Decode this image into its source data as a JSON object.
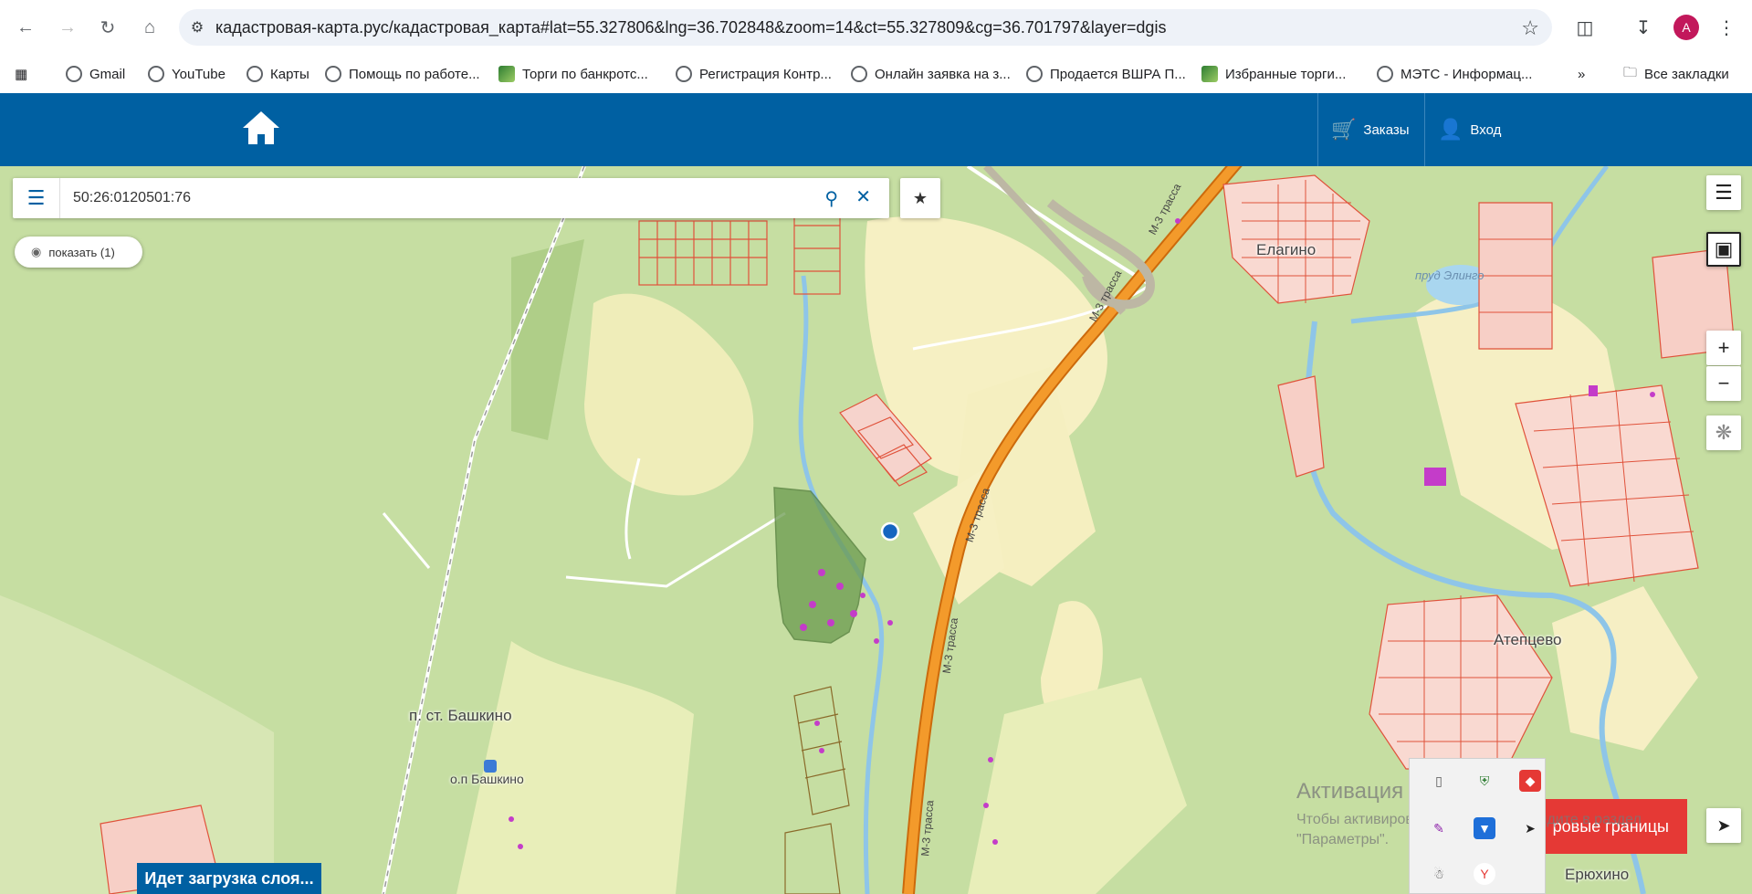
{
  "browser": {
    "url": "кадастровая-карта.рус/кадастровая_карта#lat=55.327806&lng=36.702848&zoom=14&ct=55.327809&cg=36.701797&layer=dgis",
    "avatar_letter": "A",
    "bookmarks": [
      {
        "label": "Gmail",
        "icon": "gmail-icon"
      },
      {
        "label": "YouTube",
        "icon": "globe-icon"
      },
      {
        "label": "Карты",
        "icon": "globe-icon"
      },
      {
        "label": "Помощь по работе...",
        "icon": "globe-icon"
      },
      {
        "label": "Торги по банкротс...",
        "icon": "hammer-icon"
      },
      {
        "label": "Регистрация Контр...",
        "icon": "globe-icon"
      },
      {
        "label": "Онлайн заявка на з...",
        "icon": "globe-icon"
      },
      {
        "label": "Продается ВШРА П...",
        "icon": "globe-icon"
      },
      {
        "label": "Избранные торги...",
        "icon": "hammer-icon"
      },
      {
        "label": "МЭТС - Информац...",
        "icon": "globe-icon"
      }
    ],
    "all_bookmarks_label": "Все закладки"
  },
  "header": {
    "orders_label": "Заказы",
    "login_label": "Вход"
  },
  "search": {
    "value": "50:26:0120501:76"
  },
  "show_button": "показать (1)",
  "map_labels": {
    "elagino": "Елагино",
    "atepcevo": "Атепцево",
    "bashkino_st": "п. ст. Башкино",
    "bashkino_op": "о.п Башкино",
    "eryuhino": "Ерюхино",
    "pond": "пруд Элинго",
    "m3_1": "М-3 трасса",
    "m3_2": "М-3 трасса",
    "m3_3": "М-3 трасса",
    "m3_4": "М-3 трасса",
    "m3_5": "М-3 трасса"
  },
  "loading_text": "Идет загрузка слоя...",
  "red_button": "ровые границы",
  "watermark": {
    "title": "Активация Windows",
    "line1": "Чтобы активировать Windows, перейдите в раздел",
    "line2": "\"Параметры\"."
  },
  "colors": {
    "header_blue": "#0060a2",
    "map_green": "#c6dea2",
    "highway_orange": "#f39a2b",
    "parcel_red": "#e0523b",
    "accent_red": "#e53935"
  }
}
